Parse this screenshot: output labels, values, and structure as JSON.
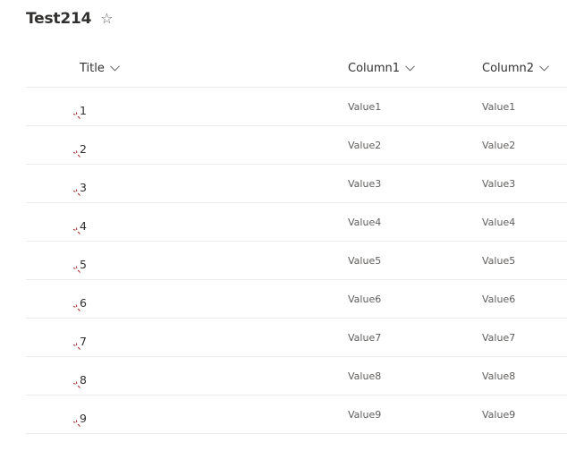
{
  "list": {
    "title": "Test214",
    "favorite_icon": "star-outline-icon"
  },
  "columns": [
    {
      "label": "Title"
    },
    {
      "label": "Column1"
    },
    {
      "label": "Column2"
    }
  ],
  "rows": [
    {
      "title": "1",
      "column1": "Value1",
      "column2": "Value1"
    },
    {
      "title": "2",
      "column1": "Value2",
      "column2": "Value2"
    },
    {
      "title": "3",
      "column1": "Value3",
      "column2": "Value3"
    },
    {
      "title": "4",
      "column1": "Value4",
      "column2": "Value4"
    },
    {
      "title": "5",
      "column1": "Value5",
      "column2": "Value5"
    },
    {
      "title": "6",
      "column1": "Value6",
      "column2": "Value6"
    },
    {
      "title": "7",
      "column1": "Value7",
      "column2": "Value7"
    },
    {
      "title": "8",
      "column1": "Value8",
      "column2": "Value8"
    },
    {
      "title": "9",
      "column1": "Value9",
      "column2": "Value9"
    }
  ],
  "colors": {
    "new_item_glyph": "#a4262c",
    "row_divider": "#edebe9",
    "text_primary": "#323130",
    "text_secondary": "#605e5c"
  }
}
